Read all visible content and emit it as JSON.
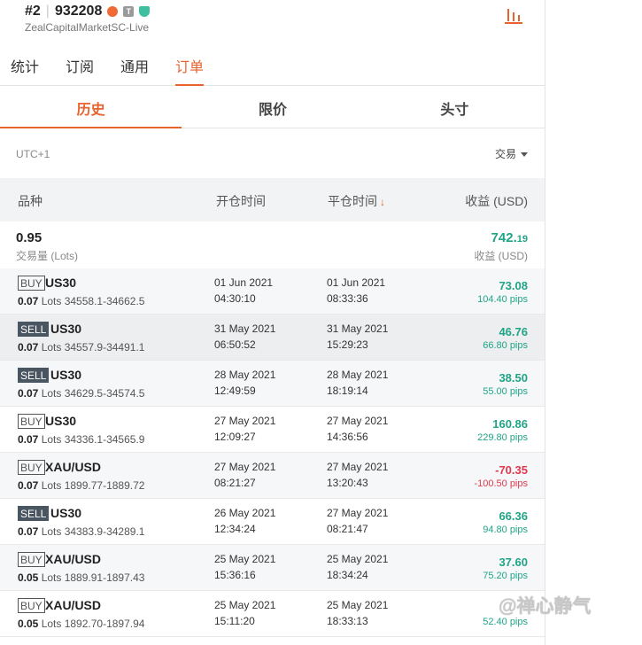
{
  "account": {
    "index": "#2",
    "number": "932208",
    "server": "ZealCapitalMarketSC-Live",
    "badge_t": "T"
  },
  "main_tabs": [
    {
      "label": "统计",
      "active": false
    },
    {
      "label": "订阅",
      "active": false
    },
    {
      "label": "通用",
      "active": false
    },
    {
      "label": "订单",
      "active": true
    }
  ],
  "sub_tabs": [
    {
      "label": "历史",
      "active": true
    },
    {
      "label": "限价",
      "active": false
    },
    {
      "label": "头寸",
      "active": false
    }
  ],
  "timezone": "UTC+1",
  "filter_label": "交易",
  "columns": {
    "symbol": "品种",
    "open_time": "开仓时间",
    "close_time": "平仓时间",
    "profit": "收益 (USD)",
    "sort_arrow": "↓"
  },
  "summary": {
    "lots": "0.95",
    "lots_label": "交易量 (Lots)",
    "profit_main": "742.",
    "profit_dec": "19",
    "profit_label": "收益 (USD)"
  },
  "orders": [
    {
      "side": "BUY",
      "symbol": "US30",
      "lots": "0.07",
      "lots_suffix": " Lots 34558.1-34662.5",
      "open_date": "01 Jun 2021",
      "open_time": "04:30:10",
      "close_date": "01 Jun 2021",
      "close_time": "08:33:36",
      "profit": "73.08",
      "pips": "104.40 pips"
    },
    {
      "side": "SELL",
      "symbol": "US30",
      "lots": "0.07",
      "lots_suffix": " Lots 34557.9-34491.1",
      "open_date": "31 May 2021",
      "open_time": "06:50:52",
      "close_date": "31 May 2021",
      "close_time": "15:29:23",
      "profit": "46.76",
      "pips": "66.80 pips"
    },
    {
      "side": "SELL",
      "symbol": "US30",
      "lots": "0.07",
      "lots_suffix": " Lots 34629.5-34574.5",
      "open_date": "28 May 2021",
      "open_time": "12:49:59",
      "close_date": "28 May 2021",
      "close_time": "18:19:14",
      "profit": "38.50",
      "pips": "55.00 pips"
    },
    {
      "side": "BUY",
      "symbol": "US30",
      "lots": "0.07",
      "lots_suffix": " Lots 34336.1-34565.9",
      "open_date": "27 May 2021",
      "open_time": "12:09:27",
      "close_date": "27 May 2021",
      "close_time": "14:36:56",
      "profit": "160.86",
      "pips": "229.80 pips"
    },
    {
      "side": "BUY",
      "symbol": "XAU/USD",
      "lots": "0.07",
      "lots_suffix": " Lots 1899.77-1889.72",
      "open_date": "27 May 2021",
      "open_time": "08:21:27",
      "close_date": "27 May 2021",
      "close_time": "13:20:43",
      "profit": "-70.35",
      "pips": "-100.50 pips"
    },
    {
      "side": "SELL",
      "symbol": "US30",
      "lots": "0.07",
      "lots_suffix": " Lots 34383.9-34289.1",
      "open_date": "26 May 2021",
      "open_time": "12:34:24",
      "close_date": "27 May 2021",
      "close_time": "08:21:47",
      "profit": "66.36",
      "pips": "94.80 pips"
    },
    {
      "side": "BUY",
      "symbol": "XAU/USD",
      "lots": "0.05",
      "lots_suffix": " Lots 1889.91-1897.43",
      "open_date": "25 May 2021",
      "open_time": "15:36:16",
      "close_date": "25 May 2021",
      "close_time": "18:34:24",
      "profit": "37.60",
      "pips": "75.20 pips"
    },
    {
      "side": "BUY",
      "symbol": "XAU/USD",
      "lots": "0.05",
      "lots_suffix": " Lots 1892.70-1897.94",
      "open_date": "25 May 2021",
      "open_time": "15:11:20",
      "close_date": "25 May 2021",
      "close_time": "18:33:13",
      "profit": "",
      "pips": "52.40 pips"
    }
  ],
  "watermark": "@禅心静气",
  "colors": {
    "accent": "#e8622c",
    "profit": "#20a487",
    "loss": "#e0394e",
    "sell_badge": "#4a5562"
  }
}
